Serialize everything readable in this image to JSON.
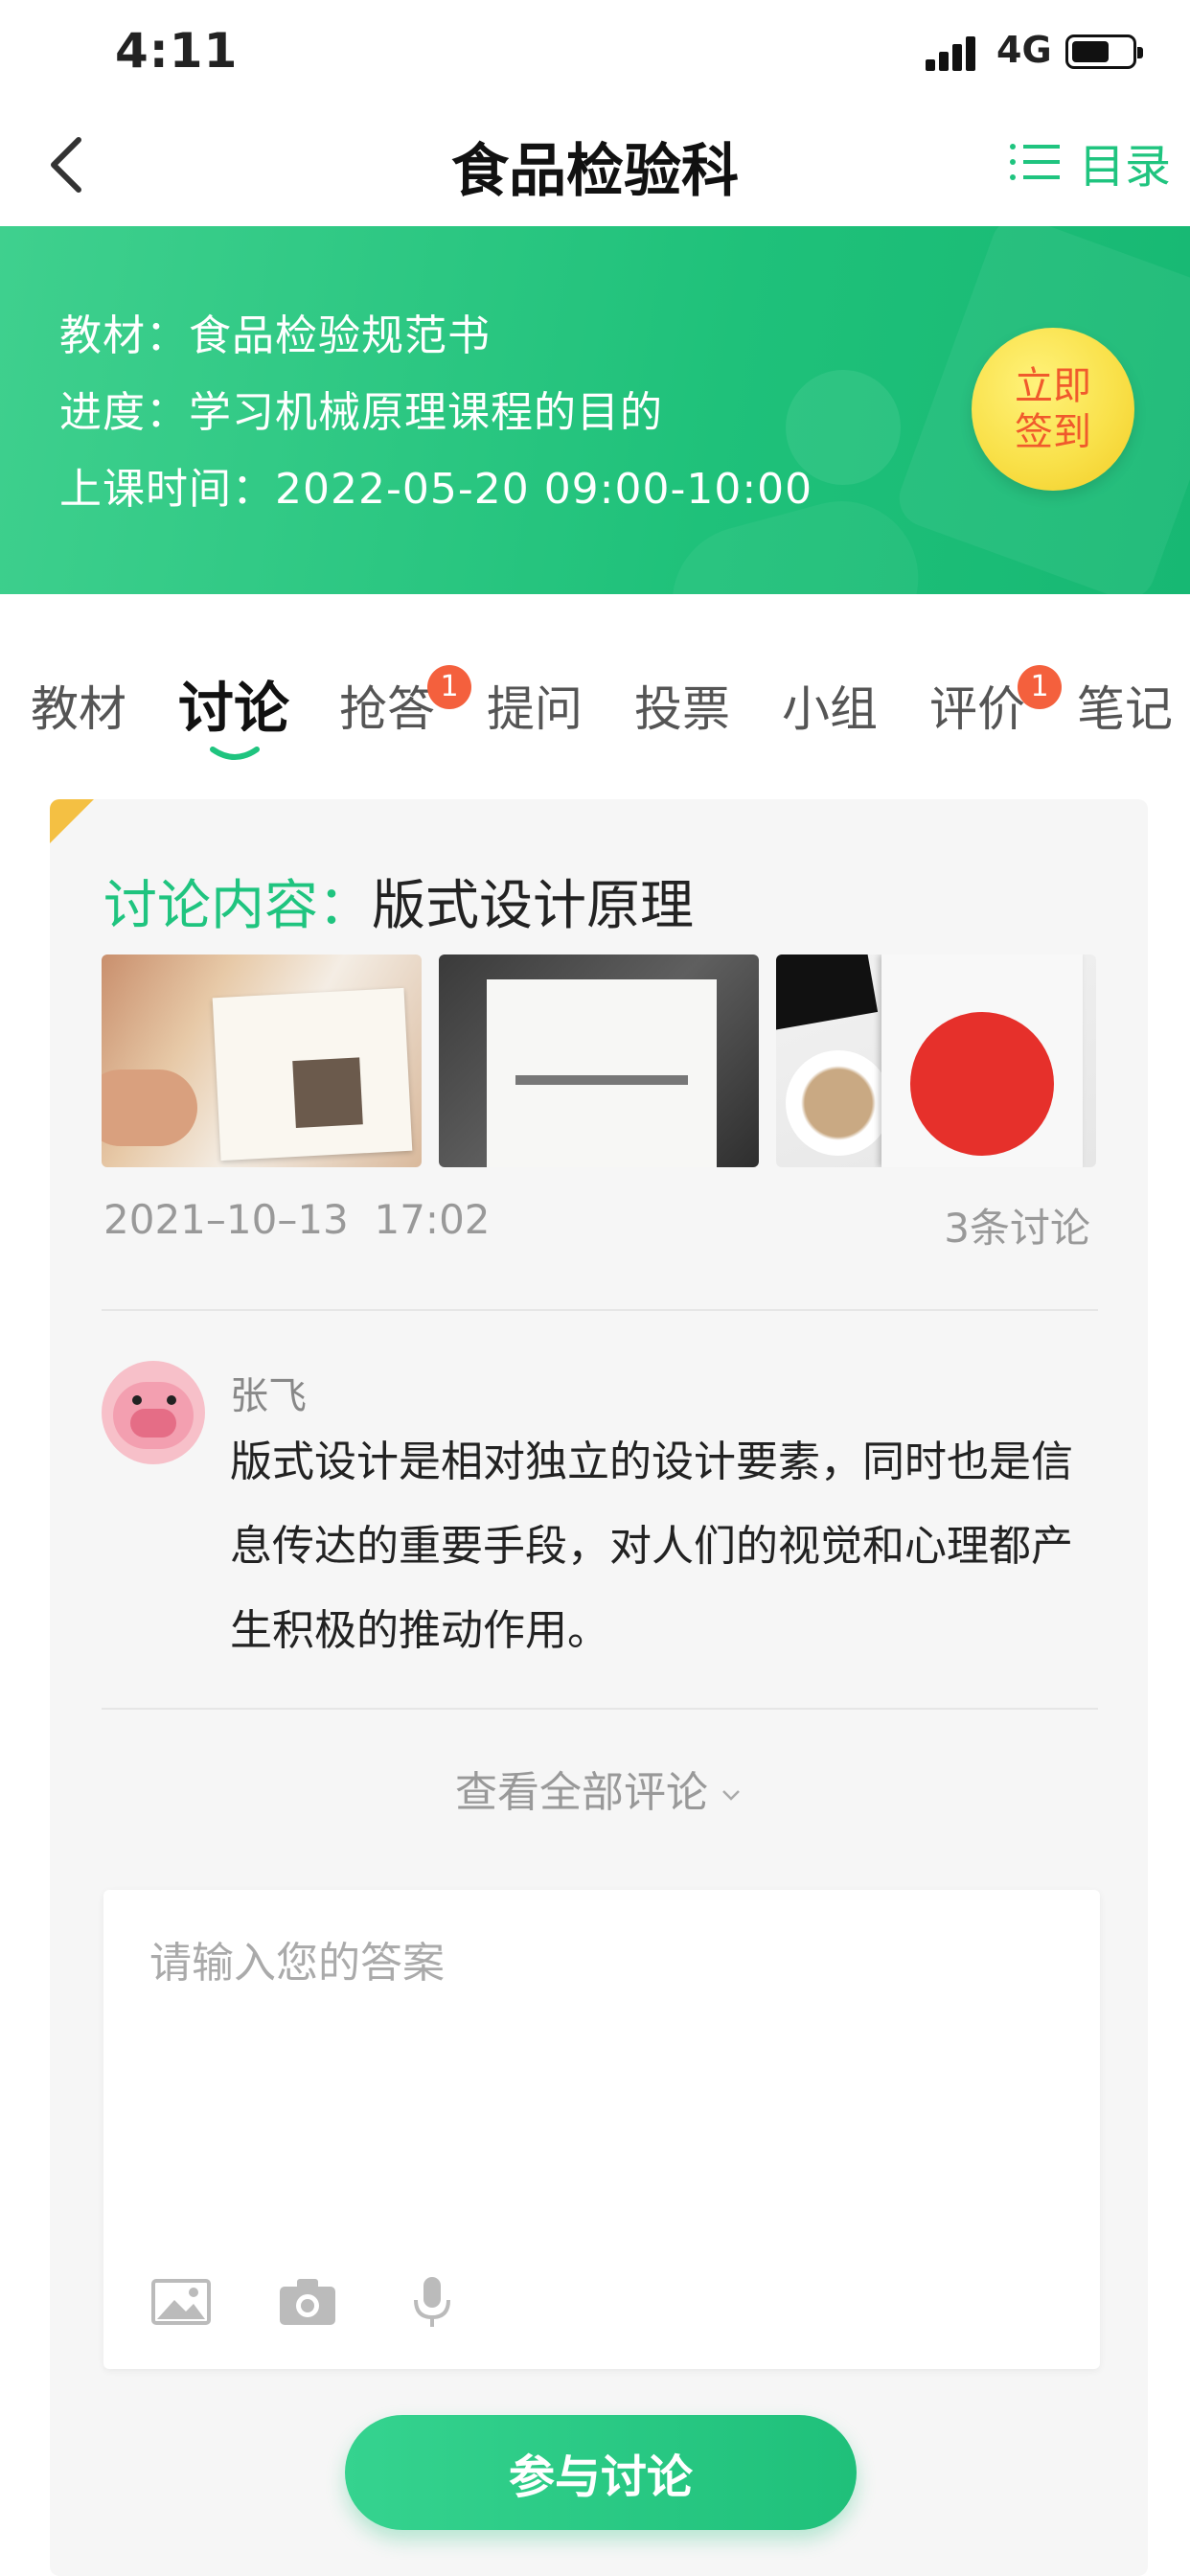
{
  "status_bar": {
    "time": "4:11",
    "network": "4G"
  },
  "nav": {
    "title": "食品检验科",
    "catalog_label": "目录",
    "back_icon": "chevron-left-icon",
    "catalog_icon": "list-icon"
  },
  "banner": {
    "textbook": "教材：食品检验规范书",
    "progress": "进度：学习机械原理课程的目的",
    "class_time": "上课时间：2022-05-20  09:00-10:00",
    "checkin_label": "立即签到"
  },
  "tabs": [
    {
      "label": "教材",
      "badge": ""
    },
    {
      "label": "讨论",
      "badge": "",
      "active": true
    },
    {
      "label": "抢答",
      "badge": "1"
    },
    {
      "label": "提问",
      "badge": ""
    },
    {
      "label": "投票",
      "badge": ""
    },
    {
      "label": "小组",
      "badge": ""
    },
    {
      "label": "评价",
      "badge": "1"
    },
    {
      "label": "笔记",
      "badge": ""
    }
  ],
  "discussion": {
    "topic_label": "讨论内容：",
    "topic_value": "版式设计原理",
    "date": "2021–10–13",
    "time": "17:02",
    "comment_count": "3条讨论",
    "comment": {
      "author": "张飞",
      "text": "版式设计是相对独立的设计要素，同时也是信息传达的重要手段，对人们的视觉和心理都产生积极的推动作用。"
    },
    "view_all": "查看全部评论",
    "answer_placeholder": "请输入您的答案",
    "join_button": "参与讨论"
  },
  "colors": {
    "brand_green": "#1fc47f",
    "badge_red": "#f4603d",
    "checkin_yellow": "#f9e14a",
    "corner_orange": "#f4c043"
  }
}
